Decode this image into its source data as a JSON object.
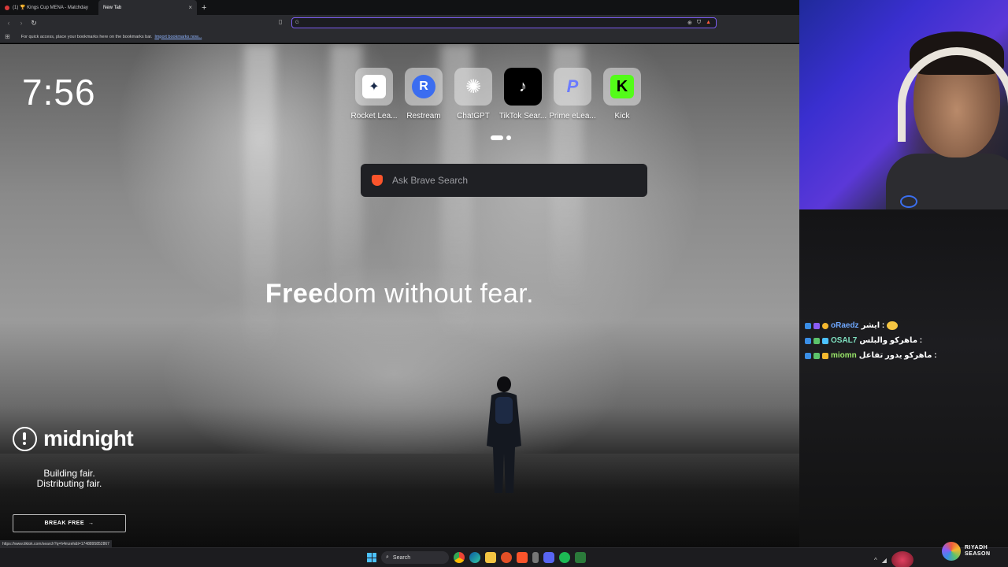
{
  "tabs": [
    {
      "label": "(1) 🏆 Kings Cup MENA - Matchday",
      "active": false
    },
    {
      "label": "New Tab",
      "active": true
    }
  ],
  "address_bar": {
    "value": "",
    "engine_icon": "G"
  },
  "bookmarks_bar": {
    "hint": "For quick access, place your bookmarks here on the bookmarks bar.",
    "import_link": "Import bookmarks now..."
  },
  "clock": "7:56",
  "shortcuts": [
    {
      "label": "Rocket Lea...",
      "icon": "rocket-league-icon",
      "glyph": "✦",
      "bg": "#ffffff",
      "fg": "#1a2a4a"
    },
    {
      "label": "Restream",
      "icon": "restream-icon",
      "glyph": "R",
      "bg": "#3b6df0",
      "fg": "#ffffff"
    },
    {
      "label": "ChatGPT",
      "icon": "chatgpt-icon",
      "glyph": "✺",
      "bg": "transparent",
      "fg": "#ffffff"
    },
    {
      "label": "TikTok Sear...",
      "icon": "tiktok-icon",
      "glyph": "♪",
      "bg": "#000000",
      "fg": "#ffffff"
    },
    {
      "label": "Prime eLea...",
      "icon": "prime-icon",
      "glyph": "P",
      "bg": "transparent",
      "fg": "#6b7bff"
    },
    {
      "label": "Kick",
      "icon": "kick-icon",
      "glyph": "K",
      "bg": "#53fc18",
      "fg": "#000000"
    }
  ],
  "search": {
    "placeholder": "Ask Brave Search"
  },
  "tagline": {
    "bold": "Free",
    "rest": "dom without fear."
  },
  "sponsor": {
    "name": "midnight",
    "tagline_1": "Building fair.",
    "tagline_2": "Distributing fair.",
    "cta": "BREAK FREE"
  },
  "status_url": "https://www.tiktok.com/search?q=h4mzeh&t=1748895852867",
  "chat": [
    {
      "user": "oRaedz",
      "message": "ايشر :"
    },
    {
      "user": "OSAL7",
      "message": "ماهركو والبلس :"
    },
    {
      "user": "miomn",
      "message": "ماهركو يدور تفاعل :"
    }
  ],
  "taskbar": {
    "search_label": "Search"
  },
  "riyadh_season": {
    "line1": "RIYADH",
    "line2": "SEASON"
  },
  "colors": {
    "accent": "#7b5cf0",
    "brave": "#fb542b",
    "link": "#8fb4ff"
  }
}
